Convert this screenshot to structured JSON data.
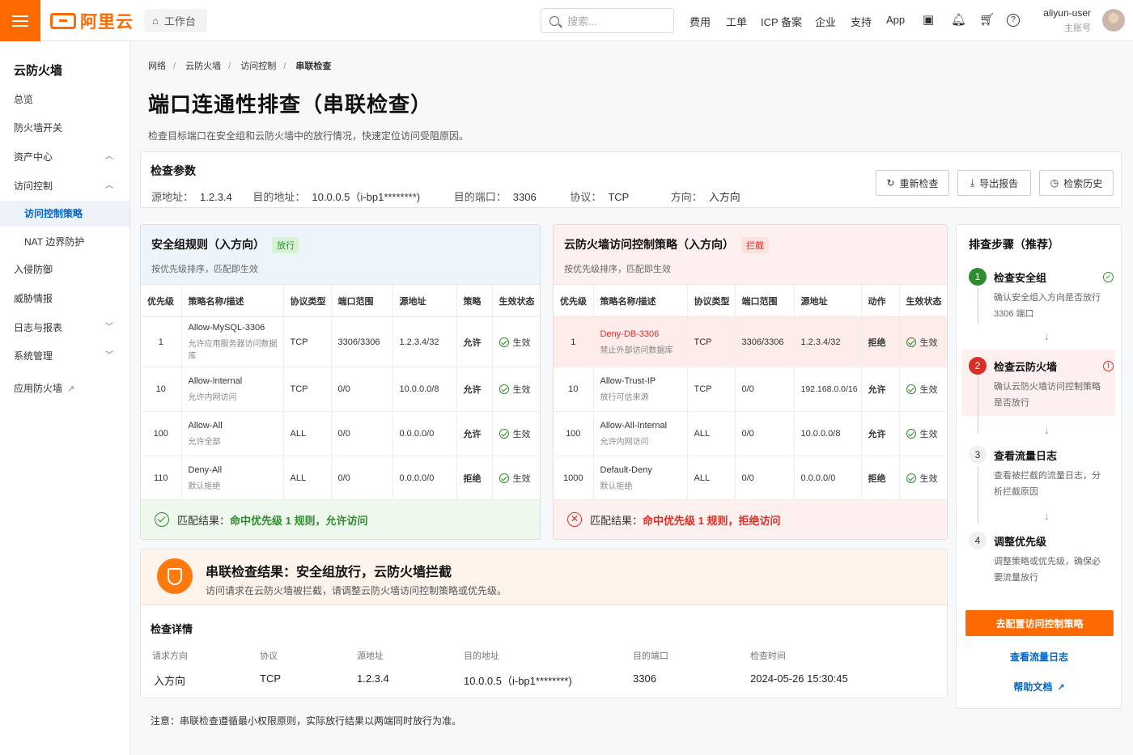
{
  "topbar": {
    "brand": "阿里云",
    "workbench": "工作台",
    "search_placeholder": "搜索...",
    "nav": [
      "费用",
      "工单",
      "ICP 备案",
      "企业",
      "支持",
      "App"
    ],
    "user_name": "aliyun-user",
    "user_role": "主账号"
  },
  "sidebar": {
    "title": "云防火墙",
    "items": [
      {
        "label": "总览"
      },
      {
        "label": "防火墙开关"
      },
      {
        "label": "资产中心"
      },
      {
        "label": "访问控制"
      },
      {
        "label": "访问控制策略"
      },
      {
        "label": "NAT 边界防护"
      },
      {
        "label": "入侵防御"
      },
      {
        "label": "威胁情报"
      },
      {
        "label": "日志与报表"
      },
      {
        "label": "系统管理"
      },
      {
        "label": "应用防火墙"
      }
    ]
  },
  "breadcrumb": [
    "网络",
    "云防火墙",
    "访问控制",
    "串联检查"
  ],
  "page": {
    "title": "端口连通性排查（串联检查）",
    "desc": "检查目标端口在安全组和云防火墙中的放行情况，快速定位访问受阻原因。"
  },
  "params": {
    "title": "检查参数",
    "src_label": "源地址：",
    "src": "1.2.3.4",
    "dst_label": "目的地址：",
    "dst": "10.0.0.5（i-bp1********)",
    "port_label": "目的端口：",
    "port": "3306",
    "proto_label": "协议：",
    "proto": "TCP",
    "dir_label": "方向：",
    "dir": "入方向",
    "btn_recheck": "重新检查",
    "btn_export": "导出报告",
    "btn_history": "检索历史"
  },
  "sg": {
    "title": "安全组规则（入方向）",
    "tag": "放行",
    "sub": "按优先级排序，匹配即生效",
    "headers": [
      "优先级",
      "策略名称/描述",
      "协议类型",
      "端口范围",
      "源地址",
      "策略",
      "生效状态"
    ],
    "rows": [
      {
        "pri": "1",
        "name": "Allow-MySQL-3306",
        "desc": "允许应用服务器访问数据库",
        "proto": "TCP",
        "port": "3306/3306",
        "src": "1.2.3.4/32",
        "action": "允许",
        "status": "生效"
      },
      {
        "pri": "10",
        "name": "Allow-Internal",
        "desc": "允许内网访问",
        "proto": "TCP",
        "port": "0/0",
        "src": "10.0.0.0/8",
        "action": "允许",
        "status": "生效"
      },
      {
        "pri": "100",
        "name": "Allow-All",
        "desc": "允许全部",
        "proto": "ALL",
        "port": "0/0",
        "src": "0.0.0.0/0",
        "action": "允许",
        "status": "生效"
      },
      {
        "pri": "110",
        "name": "Deny-All",
        "desc": "默认拒绝",
        "proto": "ALL",
        "port": "0/0",
        "src": "0.0.0.0/0",
        "action": "拒绝",
        "status": "生效"
      }
    ],
    "match_label": "匹配结果：",
    "match_value": "命中优先级 1 规则，允许访问"
  },
  "fw": {
    "title": "云防火墙访问控制策略（入方向）",
    "tag": "拦截",
    "sub": "按优先级排序，匹配即生效",
    "headers": [
      "优先级",
      "策略名称/描述",
      "协议类型",
      "端口范围",
      "源地址",
      "动作",
      "生效状态"
    ],
    "rows": [
      {
        "pri": "1",
        "name": "Deny-DB-3306",
        "desc": "禁止外部访问数据库",
        "proto": "TCP",
        "port": "3306/3306",
        "src": "1.2.3.4/32",
        "action": "拒绝",
        "status": "生效"
      },
      {
        "pri": "10",
        "name": "Allow-Trust-IP",
        "desc": "放行可信来源",
        "proto": "TCP",
        "port": "0/0",
        "src": "192.168.0.0/16",
        "action": "允许",
        "status": "生效"
      },
      {
        "pri": "100",
        "name": "Allow-All-Internal",
        "desc": "允许内网访问",
        "proto": "ALL",
        "port": "0/0",
        "src": "10.0.0.0/8",
        "action": "允许",
        "status": "生效"
      },
      {
        "pri": "1000",
        "name": "Default-Deny",
        "desc": "默认拒绝",
        "proto": "ALL",
        "port": "0/0",
        "src": "0.0.0.0/0",
        "action": "拒绝",
        "status": "生效"
      }
    ],
    "match_label": "匹配结果：",
    "match_value": "命中优先级 1 规则，拒绝访问"
  },
  "steps": {
    "title": "排查步骤（推荐）",
    "items": [
      {
        "num": "1",
        "title": "检查安全组",
        "desc": "确认安全组入方向是否放行 3306 端口"
      },
      {
        "num": "2",
        "title": "检查云防火墙",
        "desc": "确认云防火墙访问控制策略是否放行"
      },
      {
        "num": "3",
        "title": "查看流量日志",
        "desc": "查看被拦截的流量日志，分析拦截原因"
      },
      {
        "num": "4",
        "title": "调整优先级",
        "desc": "调整策略或优先级，确保必要流量放行"
      }
    ],
    "primary_btn": "去配置访问控制策略",
    "link_logs": "查看流量日志",
    "link_help": "帮助文档"
  },
  "result": {
    "title": "串联检查结果：安全组放行，云防火墙拦截",
    "desc": "访问请求在云防火墙被拦截，请调整云防火墙访问控制策略或优先级。",
    "details_title": "检查详情",
    "details": [
      {
        "k": "请求方向",
        "v": "入方向"
      },
      {
        "k": "协议",
        "v": "TCP"
      },
      {
        "k": "源地址",
        "v": "1.2.3.4"
      },
      {
        "k": "目的地址",
        "v": "10.0.0.5（i-bp1********)"
      },
      {
        "k": "目的端口",
        "v": "3306"
      },
      {
        "k": "检查时间",
        "v": "2024-05-26 15:30:45"
      }
    ]
  },
  "note": "注意：串联检查遵循最小权限原则，实际放行结果以两端同时放行为准。",
  "colors": {
    "brand": "#ff6a00",
    "link": "#0064c8",
    "allow": "#2e8b2e",
    "deny": "#d93026"
  }
}
